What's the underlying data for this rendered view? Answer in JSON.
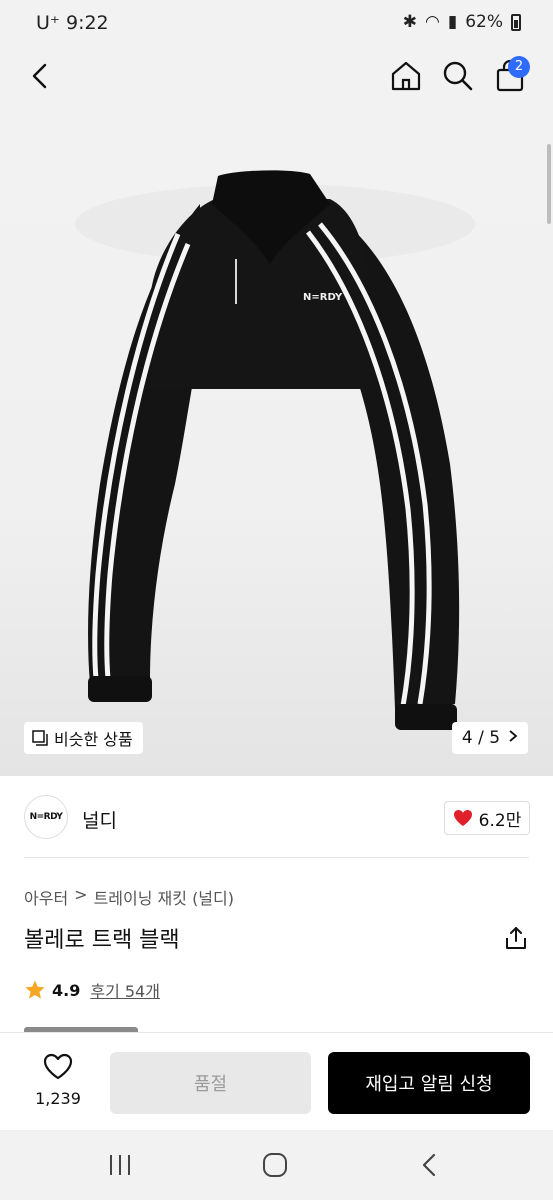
{
  "status_bar": {
    "carrier_time": "U⁺ 9:22",
    "battery": "62%"
  },
  "cart": {
    "count": "2"
  },
  "gallery": {
    "similar_label": "비슷한 상품",
    "counter": "4 / 5",
    "logo_text": "N=RDY"
  },
  "brand": {
    "logo_text": "N=RDY",
    "name": "널디",
    "likes": "6.2만"
  },
  "breadcrumb": {
    "category": "아우터",
    "separator": ">",
    "subcategory": "트레이닝 재킷 (널디)"
  },
  "product": {
    "title": "볼레로 트랙 블랙",
    "rating": "4.9",
    "reviews": "후기 54개"
  },
  "purchase_bar": {
    "wish_count": "1,239",
    "soldout_label": "품절",
    "restock_label": "재입고 알림 신청"
  },
  "colors": {
    "accent_badge": "#2f6bff",
    "heart": "#e0202a",
    "star": "#f5a623",
    "cta": "#000000"
  }
}
